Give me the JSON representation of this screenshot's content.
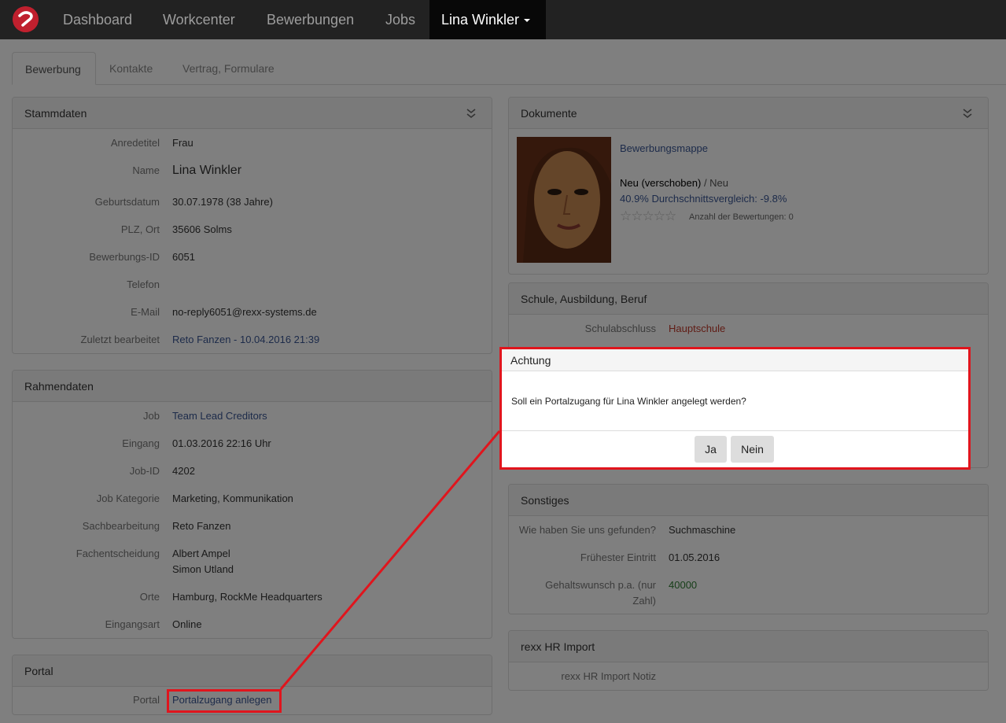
{
  "navbar": {
    "items": [
      "Dashboard",
      "Workcenter",
      "Bewerbungen",
      "Jobs"
    ],
    "user": "Lina Winkler"
  },
  "tabs": [
    "Bewerbung",
    "Kontakte",
    "Vertrag, Formulare"
  ],
  "stammdaten": {
    "title": "Stammdaten",
    "rows": [
      {
        "label": "Anredetitel",
        "value": "Frau"
      },
      {
        "label": "Name",
        "value": "Lina Winkler"
      },
      {
        "label": "Geburtsdatum",
        "value": "30.07.1978 (38 Jahre)"
      },
      {
        "label": "PLZ, Ort",
        "value": "35606 Solms"
      },
      {
        "label": "Bewerbungs-ID",
        "value": "6051"
      },
      {
        "label": "Telefon",
        "value": ""
      },
      {
        "label": "E-Mail",
        "value": "no-reply6051@rexx-systems.de"
      },
      {
        "label": "Zuletzt bearbeitet",
        "value": "Reto Fanzen - 10.04.2016 21:39"
      }
    ]
  },
  "rahmendaten": {
    "title": "Rahmendaten",
    "rows": [
      {
        "label": "Job",
        "value": "Team Lead Creditors"
      },
      {
        "label": "Eingang",
        "value": "01.03.2016 22:16 Uhr"
      },
      {
        "label": "Job-ID",
        "value": "4202"
      },
      {
        "label": "Job Kategorie",
        "value": "Marketing, Kommunikation"
      },
      {
        "label": "Sachbearbeitung",
        "value": "Reto Fanzen"
      },
      {
        "label": "Fachentscheidung",
        "value": "Albert Ampel",
        "value2": "Simon Utland"
      },
      {
        "label": "Orte",
        "value": "Hamburg, RockMe Headquarters"
      },
      {
        "label": "Eingangsart",
        "value": "Online"
      }
    ]
  },
  "portal": {
    "title": "Portal",
    "label": "Portal",
    "link": "Portalzugang anlegen"
  },
  "dokumente": {
    "title": "Dokumente",
    "link": "Bewerbungsmappe",
    "status_bold": "Neu (verschoben)",
    "status_rest": " / Neu",
    "compare": "40.9% Durchschnittsvergleich: -9.8%",
    "ratings": "Anzahl der Bewertungen: 0"
  },
  "schule": {
    "title": "Schule, Ausbildung, Beruf",
    "label": "Schulabschluss",
    "value": "Hauptschule"
  },
  "sonstiges": {
    "title": "Sonstiges",
    "rows": [
      {
        "label": "Wie haben Sie uns gefunden?",
        "value": "Suchmaschine"
      },
      {
        "label": "Frühester Eintritt",
        "value": "01.05.2016"
      },
      {
        "label": "Gehaltswunsch p.a. (nur",
        "label2": "Zahl)",
        "value": "40000"
      }
    ]
  },
  "import": {
    "title": "rexx HR Import",
    "label": "rexx HR Import Notiz"
  },
  "dialog": {
    "title": "Achtung",
    "message": "Soll ein Portalzugang für Lina Winkler angelegt werden?",
    "yes": "Ja",
    "no": "Nein"
  },
  "colors": {
    "highlight": "#e0151d",
    "link": "#3a5795",
    "brand": "#c0202e"
  }
}
